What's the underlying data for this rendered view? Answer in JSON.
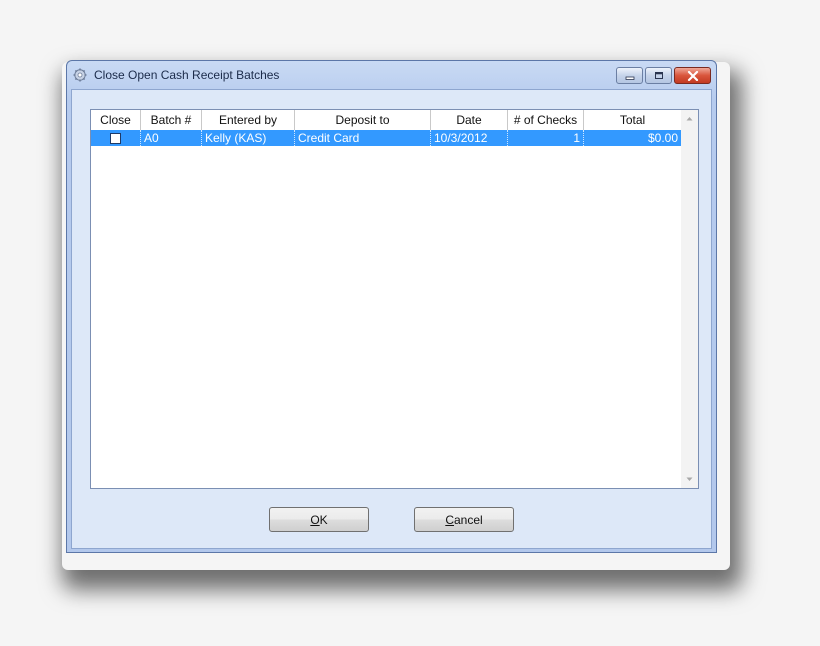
{
  "window": {
    "title": "Close Open Cash Receipt Batches",
    "icon": "gear-icon",
    "controls": [
      "minimize-icon",
      "maximize-icon",
      "close-icon"
    ]
  },
  "grid": {
    "columns": [
      "Close",
      "Batch #",
      "Entered by",
      "Deposit to",
      "Date",
      "# of Checks",
      "Total"
    ],
    "rows": [
      {
        "close": false,
        "batch": "A0",
        "entered_by": "Kelly (KAS)",
        "deposit_to": "Credit Card",
        "date": "10/3/2012",
        "checks": "1",
        "total": "$0.00"
      }
    ]
  },
  "buttons": {
    "ok_mnemonic": "O",
    "ok_rest": "K",
    "cancel_mnemonic": "C",
    "cancel_rest": "ancel"
  },
  "colors": {
    "selection": "#3399ff",
    "close_button": "#d9553c"
  }
}
